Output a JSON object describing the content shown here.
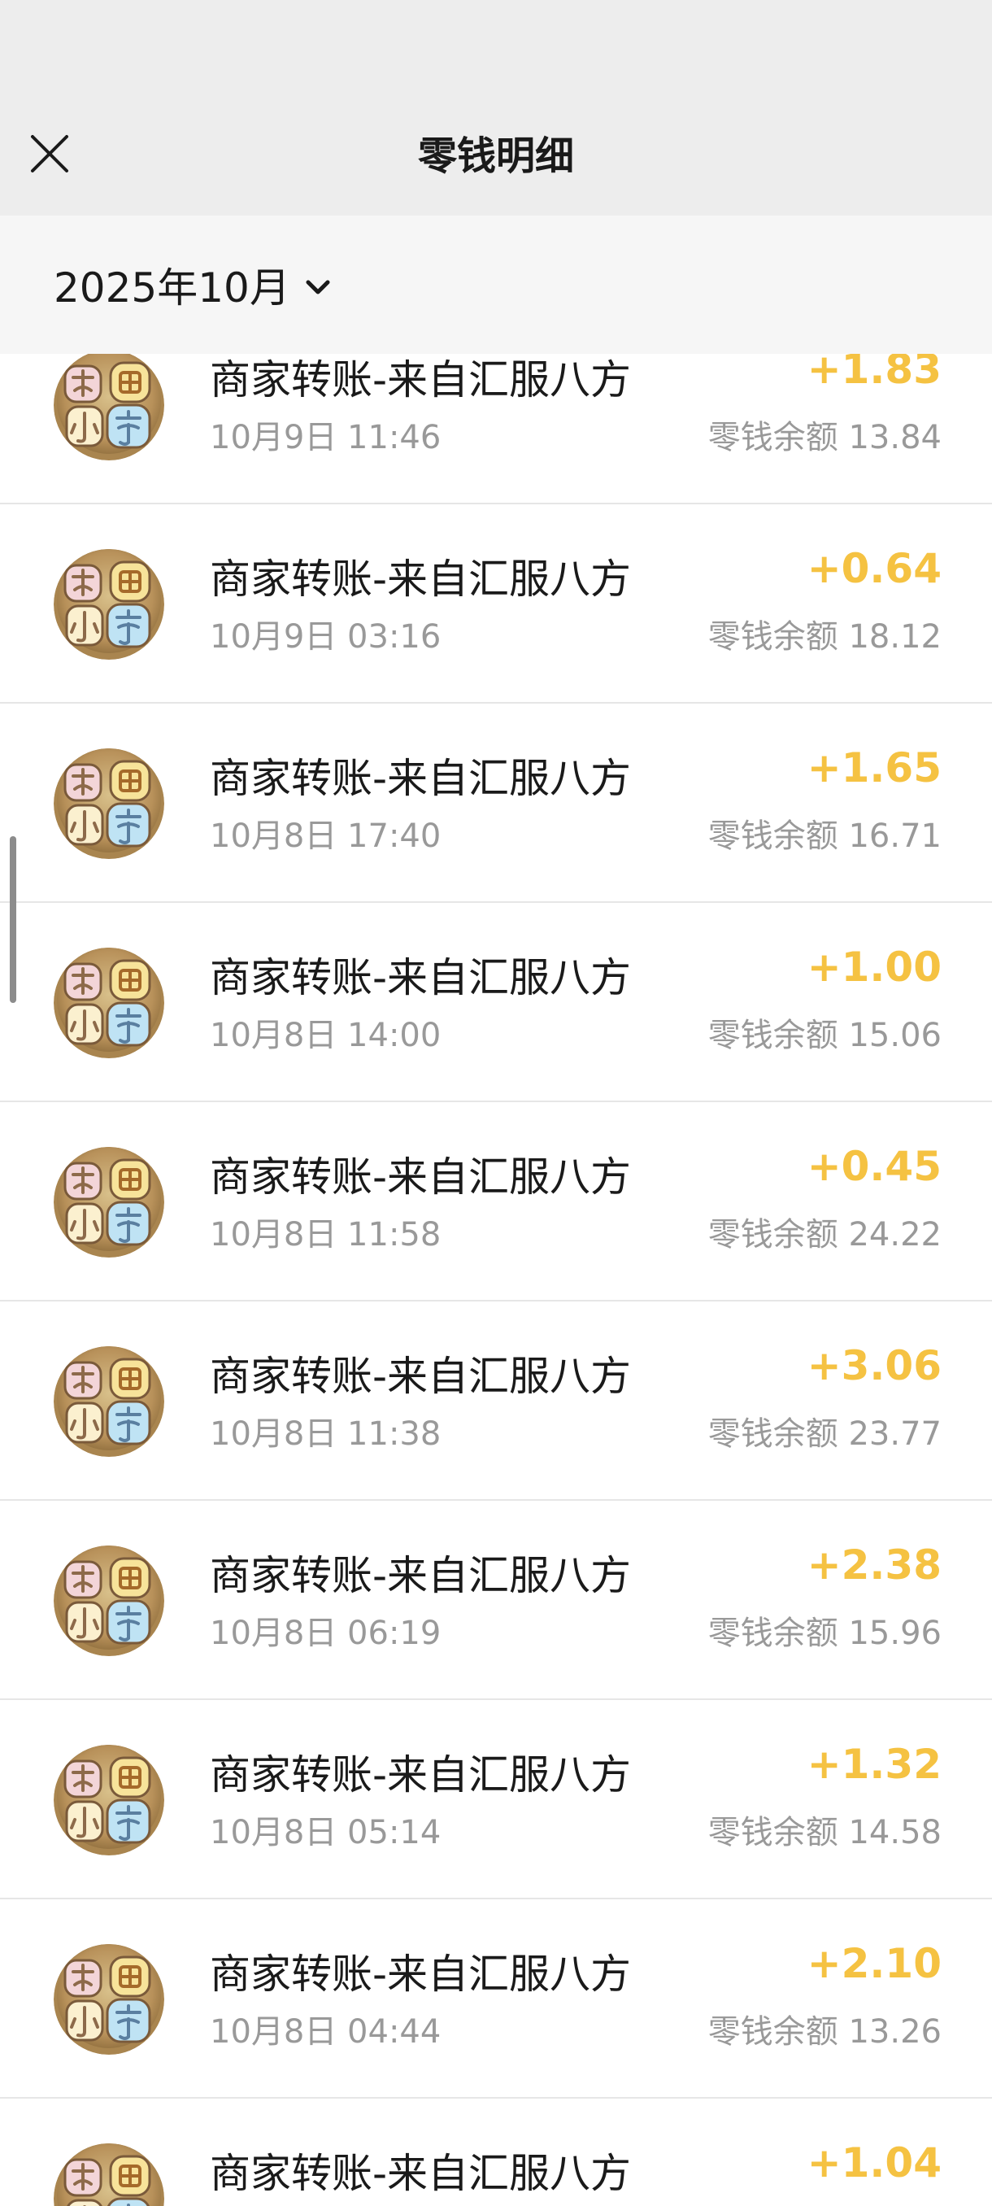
{
  "header": {
    "title": "零钱明细"
  },
  "filter": {
    "month_label": "2025年10月"
  },
  "colors": {
    "accent_amount": "#f5c242",
    "header_bg": "#ededed"
  },
  "transactions": [
    {
      "title": "商家转账-来自汇服八方",
      "time": "10月9日 11:46",
      "amount": "+1.83",
      "balance": "零钱余额 13.84"
    },
    {
      "title": "商家转账-来自汇服八方",
      "time": "10月9日 03:16",
      "amount": "+0.64",
      "balance": "零钱余额 18.12"
    },
    {
      "title": "商家转账-来自汇服八方",
      "time": "10月8日 17:40",
      "amount": "+1.65",
      "balance": "零钱余额 16.71"
    },
    {
      "title": "商家转账-来自汇服八方",
      "time": "10月8日 14:00",
      "amount": "+1.00",
      "balance": "零钱余额 15.06"
    },
    {
      "title": "商家转账-来自汇服八方",
      "time": "10月8日 11:58",
      "amount": "+0.45",
      "balance": "零钱余额 24.22"
    },
    {
      "title": "商家转账-来自汇服八方",
      "time": "10月8日 11:38",
      "amount": "+3.06",
      "balance": "零钱余额 23.77"
    },
    {
      "title": "商家转账-来自汇服八方",
      "time": "10月8日 06:19",
      "amount": "+2.38",
      "balance": "零钱余额 15.96"
    },
    {
      "title": "商家转账-来自汇服八方",
      "time": "10月8日 05:14",
      "amount": "+1.32",
      "balance": "零钱余额 14.58"
    },
    {
      "title": "商家转账-来自汇服八方",
      "time": "10月8日 04:44",
      "amount": "+2.10",
      "balance": "零钱余额 13.26"
    },
    {
      "title": "商家转账-来自汇服八方",
      "time": "",
      "amount": "+1.04",
      "balance": ""
    }
  ]
}
